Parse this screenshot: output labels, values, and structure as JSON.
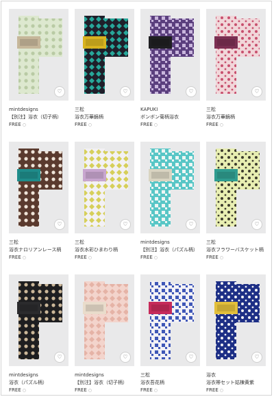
{
  "colors": {
    "frame_border": "#d4d4d4",
    "thumb_bg": "#e9e9ea"
  },
  "products": [
    {
      "brand": "mintdesigns",
      "name": "【別注】浴衣（切子柄）",
      "price": "FREE",
      "price_icon": "○",
      "fav_icon": "♡",
      "colors": {
        "fabric": "#dde8cf",
        "pattern": "#b9cba4",
        "obi": "#c6b79a"
      }
    },
    {
      "brand": "三松",
      "name": "浴衣万華鏡柄",
      "price": "FREE",
      "price_icon": "○",
      "fav_icon": "♡",
      "colors": {
        "fabric": "#1f1f2a",
        "pattern": "#27a79a",
        "obi": "#d8b31f"
      }
    },
    {
      "brand": "KAPUKI",
      "name": "ボンボン菊柄浴衣",
      "price": "FREE",
      "price_icon": "○",
      "fav_icon": "♡",
      "colors": {
        "fabric": "#5b3f7e",
        "pattern": "#c9b6dd",
        "obi": "#1f1f22"
      }
    },
    {
      "brand": "三松",
      "name": "浴衣万華鏡柄",
      "price": "FREE",
      "price_icon": "○",
      "fav_icon": "♡",
      "colors": {
        "fabric": "#f1d6d9",
        "pattern": "#c8506e",
        "obi": "#7b2f52"
      }
    },
    {
      "brand": "三松",
      "name": "浴衣ナロリアンレース柄",
      "price": "FREE",
      "price_icon": "○",
      "fav_icon": "♡",
      "colors": {
        "fabric": "#5a3a2e",
        "pattern": "#efe4d8",
        "obi": "#1f8c8a"
      }
    },
    {
      "brand": "三松",
      "name": "浴衣水彩ひまわり柄",
      "price": "FREE",
      "price_icon": "○",
      "fav_icon": "♡",
      "colors": {
        "fabric": "#f3f1f4",
        "pattern": "#d6cf5a",
        "obi": "#c8a6cf"
      }
    },
    {
      "brand": "mintdesigns",
      "name": "【別注】浴衣（パズル柄）",
      "price": "FREE",
      "price_icon": "○",
      "fav_icon": "♡",
      "colors": {
        "fabric": "#58c6c6",
        "pattern": "#eef6f4",
        "obi": "#d9d4c1"
      }
    },
    {
      "brand": "三松",
      "name": "浴衣フラワーバスケット柄",
      "price": "FREE",
      "price_icon": "○",
      "fav_icon": "♡",
      "colors": {
        "fabric": "#e8eeb2",
        "pattern": "#3c3a2d",
        "obi": "#2f9c8f"
      }
    },
    {
      "brand": "mintdesigns",
      "name": "浴衣（パズル柄）",
      "price": "FREE",
      "price_icon": "○",
      "fav_icon": "♡",
      "colors": {
        "fabric": "#1e1e20",
        "pattern": "#cbb799",
        "obi": "#2b2b2d"
      }
    },
    {
      "brand": "mintdesigns",
      "name": "【別注】浴衣（切子柄）",
      "price": "FREE",
      "price_icon": "○",
      "fav_icon": "♡",
      "colors": {
        "fabric": "#f3d4cc",
        "pattern": "#e5b3a6",
        "obi": "#e9dccb"
      }
    },
    {
      "brand": "三松",
      "name": "浴衣吾花柄",
      "price": "FREE",
      "price_icon": "○",
      "fav_icon": "♡",
      "colors": {
        "fabric": "#f2f1f6",
        "pattern": "#3f57b7",
        "obi": "#c62a5a"
      }
    },
    {
      "brand": "浴衣",
      "name": "浴衣帯セット姑棟黄紫",
      "price": "FREE",
      "price_icon": "○",
      "fav_icon": "♡",
      "colors": {
        "fabric": "#1d2f86",
        "pattern": "#f2f2f5",
        "obi": "#e2bf3b"
      }
    }
  ]
}
